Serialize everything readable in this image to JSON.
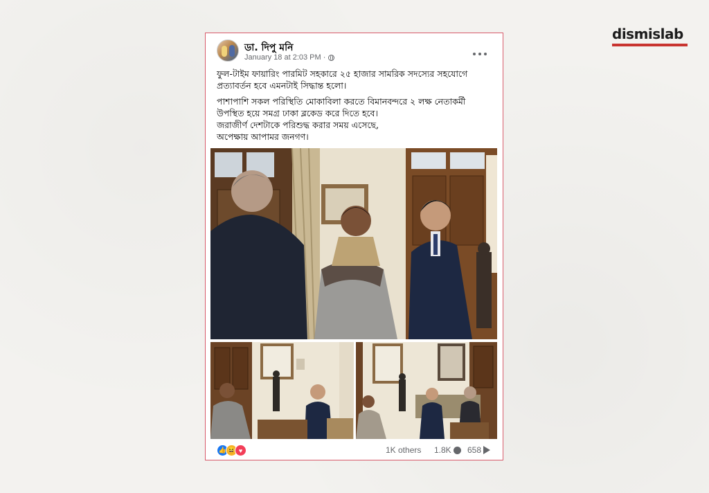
{
  "brand": {
    "name": "dismislab",
    "accent": "#c8342f"
  },
  "post": {
    "author": "ডা. দিপু মনি",
    "timestamp": "January 18 at 2:03 PM ·",
    "privacy_icon": "globe-icon",
    "more_icon": "more-options-icon",
    "paragraphs": [
      "ফুল-টাইম ফায়ারিং পারমিট সহকারে ২৫ হাজার সামরিক সদস্যের সহযোগে প্রত্যাবর্তন হবে এমনটাই সিদ্ধান্ত হলো।",
      "পাশাপাশি সকল পরিস্থিতি মোকাবিলা করতে বিমানবন্দরে ২ লক্ষ নেতাকর্মী উপস্থিত হয়ে সমগ্র ঢাকা ব্লকেড করে দিতে হবে।",
      "জরাজীর্ণ দেশটাকে পরিশুদ্ধ করার সময় এসেছে,",
      "অপেক্ষায় আপামর জনগণ।"
    ],
    "reactions": [
      "like-icon",
      "haha-icon",
      "love-icon"
    ],
    "reaction_others": "1K others",
    "comments_count": "1.8K",
    "shares_count": "658",
    "border_color": "#d85a6a"
  }
}
